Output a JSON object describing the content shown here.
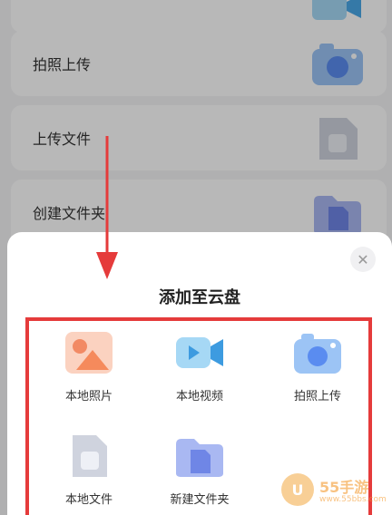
{
  "background_list": {
    "items": [
      {
        "label": "拍照上传",
        "icon": "camera-icon"
      },
      {
        "label": "上传文件",
        "icon": "file-icon"
      },
      {
        "label": "创建文件夹",
        "icon": "folder-icon"
      }
    ]
  },
  "sheet": {
    "title": "添加至云盘",
    "close_icon": "close-icon",
    "options": [
      {
        "label": "本地照片",
        "icon": "photo-icon"
      },
      {
        "label": "本地视频",
        "icon": "video-icon"
      },
      {
        "label": "拍照上传",
        "icon": "camera-icon"
      },
      {
        "label": "本地文件",
        "icon": "file-icon"
      },
      {
        "label": "新建文件夹",
        "icon": "folder-icon"
      }
    ]
  },
  "annotation": {
    "highlight_color": "#e53b3b",
    "arrow_color": "#e53b3b"
  },
  "watermark": {
    "brand": "55手游",
    "url": "www.55bbs.com"
  },
  "colors": {
    "overlay": "rgba(0,0,0,0.28)",
    "sheet_bg": "#ffffff",
    "accent_blue": "#5a8cf0"
  }
}
